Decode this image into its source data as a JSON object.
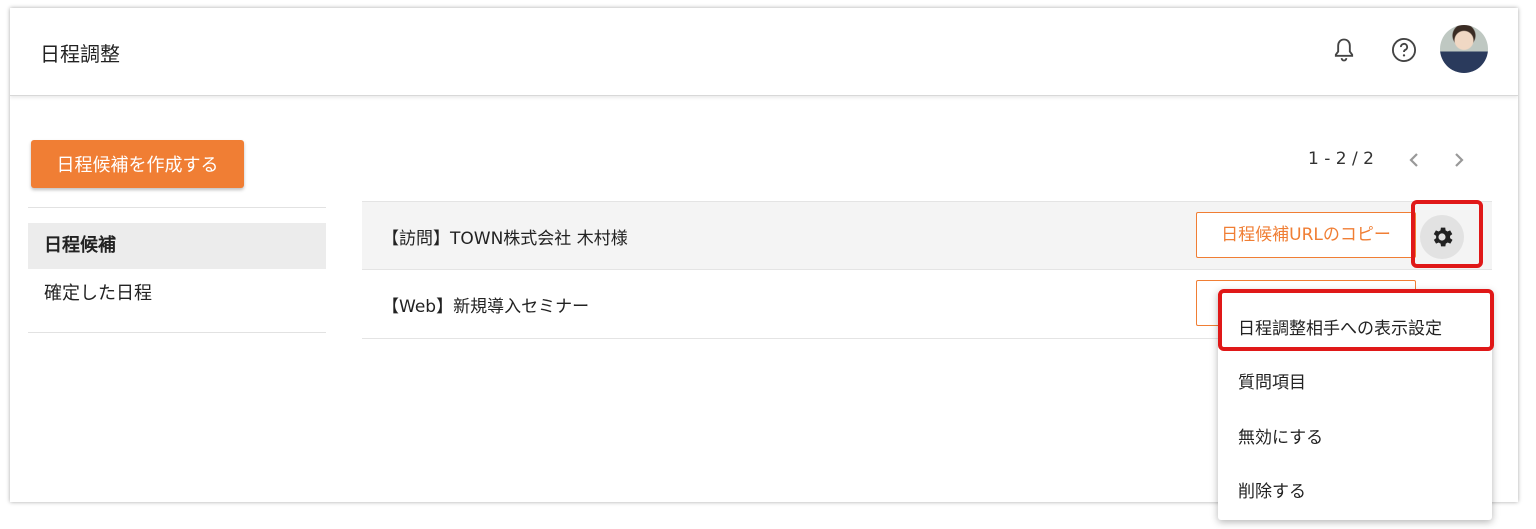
{
  "header": {
    "title": "日程調整",
    "icons": [
      "bell-icon",
      "help-icon",
      "user-avatar"
    ]
  },
  "sidebar": {
    "create_button": "日程候補を作成する",
    "items": [
      {
        "label": "日程候補",
        "active": true
      },
      {
        "label": "確定した日程",
        "active": false
      }
    ]
  },
  "pagination": {
    "range": "1 - 2 / 2",
    "prev_icon": "chevron-left-icon",
    "next_icon": "chevron-right-icon"
  },
  "list": {
    "rows": [
      {
        "title": "【訪問】TOWN株式会社 木村様",
        "copy_button": "日程候補URLのコピー"
      },
      {
        "title": "【Web】新規導入セミナー",
        "copy_button": "日程候補URLのコピー"
      }
    ]
  },
  "dropdown_menu": {
    "items": [
      "日程調整相手への表示設定",
      "質問項目",
      "無効にする",
      "削除する"
    ]
  },
  "colors": {
    "accent": "#f07e34",
    "highlight": "#e01818"
  }
}
